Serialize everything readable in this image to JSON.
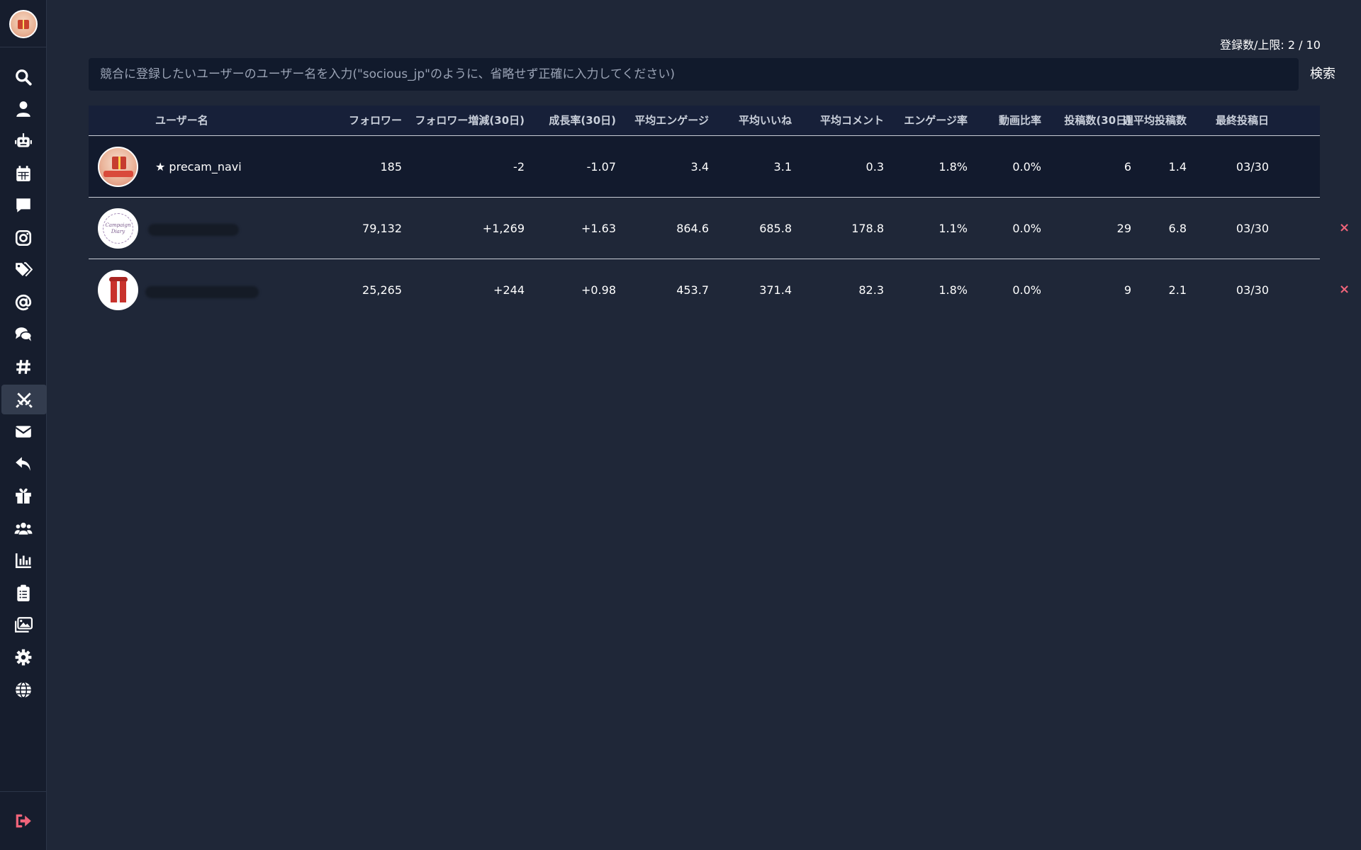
{
  "sidebar": {
    "icons": [
      "search-icon",
      "user-icon",
      "robot-icon",
      "calendar-icon",
      "comment-icon",
      "instagram-icon",
      "tags-icon",
      "at-icon",
      "comments-icon",
      "hashtag-icon",
      "swords-icon",
      "envelope-icon",
      "reply-icon",
      "gift-icon",
      "users-icon",
      "chart-bar-icon",
      "clipboard-list-icon",
      "images-icon",
      "gear-icon",
      "globe-icon"
    ],
    "active": "swords-icon",
    "logout": "sign-out-icon"
  },
  "header": {
    "registration_count": "登録数/上限: 2 / 10"
  },
  "search": {
    "placeholder": "競合に登録したいユーザーのユーザー名を入力(\"socious_jp\"のように、省略せず正確に入力してください)",
    "value": "",
    "button_label": "検索"
  },
  "table": {
    "columns": [
      "ユーザー名",
      "フォロワー",
      "フォロワー増減(30日)",
      "成長率(30日)",
      "平均エンゲージ",
      "平均いいね",
      "平均コメント",
      "エンゲージ率",
      "動画比率",
      "投稿数(30日)",
      "週平均投稿数",
      "最終投稿日"
    ],
    "rows": [
      {
        "username": "★ precam_navi",
        "followers": "185",
        "follower_change": "-2",
        "growth_rate": "-1.07",
        "avg_engage": "3.4",
        "avg_likes": "3.1",
        "avg_comments": "0.3",
        "engage_rate": "1.8%",
        "video_ratio": "0.0%",
        "posts": "6",
        "weekly_posts": "1.4",
        "last_post": "03/30",
        "own": true
      },
      {
        "username": "",
        "followers": "79,132",
        "follower_change": "+1,269",
        "growth_rate": "+1.63",
        "avg_engage": "864.6",
        "avg_likes": "685.8",
        "avg_comments": "178.8",
        "engage_rate": "1.1%",
        "video_ratio": "0.0%",
        "posts": "29",
        "weekly_posts": "6.8",
        "last_post": "03/30",
        "delete_label": "×",
        "avatar_text": "Campaign Diary"
      },
      {
        "username": "",
        "followers": "25,265",
        "follower_change": "+244",
        "growth_rate": "+0.98",
        "avg_engage": "453.7",
        "avg_likes": "371.4",
        "avg_comments": "82.3",
        "engage_rate": "1.8%",
        "video_ratio": "0.0%",
        "posts": "9",
        "weekly_posts": "2.1",
        "last_post": "03/30",
        "delete_label": "×"
      }
    ]
  }
}
